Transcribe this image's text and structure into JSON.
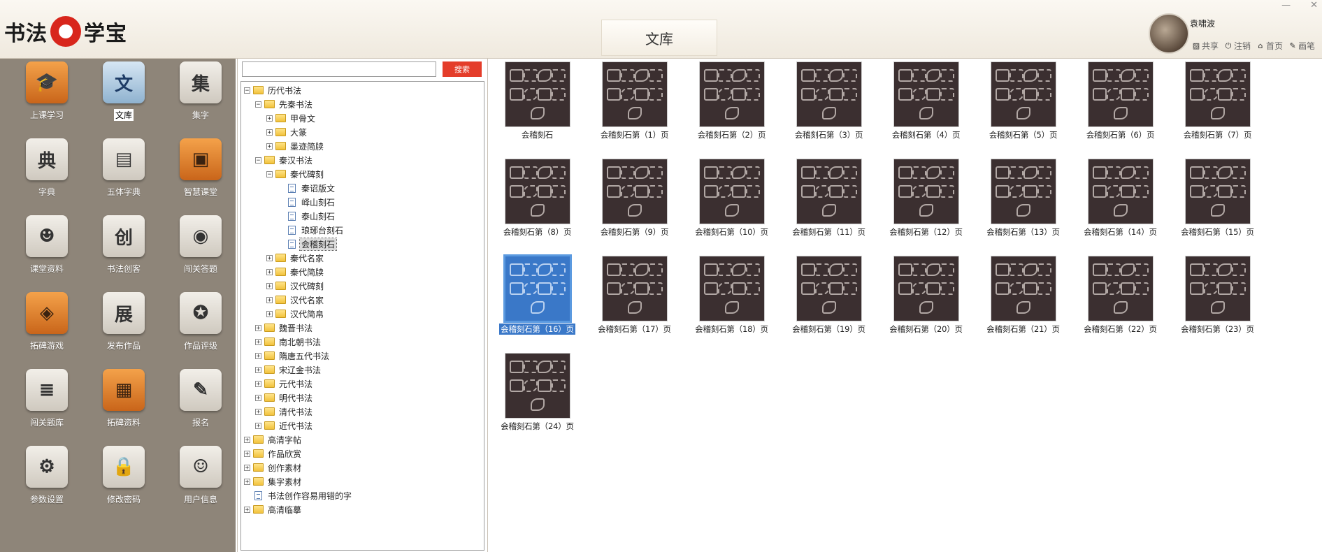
{
  "header": {
    "logo_left": "书法",
    "logo_right": "学宝",
    "page_title": "文库",
    "user_name": "袁啸波",
    "links": [
      {
        "label": "共享",
        "icon": "image-icon"
      },
      {
        "label": "注销",
        "icon": "power-icon"
      },
      {
        "label": "首页",
        "icon": "home-icon"
      },
      {
        "label": "画笔",
        "icon": "pencil-icon"
      }
    ]
  },
  "nav": {
    "items": [
      {
        "label": "上课学习",
        "glyph": "🎓",
        "style": "o"
      },
      {
        "label": "文库",
        "glyph": "文",
        "style": "b",
        "selected": true
      },
      {
        "label": "集字",
        "glyph": "集",
        "style": "g"
      },
      {
        "label": "字典",
        "glyph": "典",
        "style": "g"
      },
      {
        "label": "五体字典",
        "glyph": "▤",
        "style": "g"
      },
      {
        "label": "智慧课堂",
        "glyph": "▣",
        "style": "o"
      },
      {
        "label": "课堂资料",
        "glyph": "☻",
        "style": "g"
      },
      {
        "label": "书法创客",
        "glyph": "创",
        "style": "g"
      },
      {
        "label": "闯关答题",
        "glyph": "◉",
        "style": "g"
      },
      {
        "label": "拓碑游戏",
        "glyph": "◈",
        "style": "o"
      },
      {
        "label": "发布作品",
        "glyph": "展",
        "style": "g"
      },
      {
        "label": "作品评级",
        "glyph": "✪",
        "style": "g"
      },
      {
        "label": "闯关题库",
        "glyph": "≣",
        "style": "g"
      },
      {
        "label": "拓碑资料",
        "glyph": "▦",
        "style": "o"
      },
      {
        "label": "报名",
        "glyph": "✎",
        "style": "g"
      },
      {
        "label": "参数设置",
        "glyph": "⚙",
        "style": "g"
      },
      {
        "label": "修改密码",
        "glyph": "🔒",
        "style": "g"
      },
      {
        "label": "用户信息",
        "glyph": "☺",
        "style": "g"
      }
    ]
  },
  "search": {
    "value": "",
    "placeholder": "",
    "button_label": "搜索"
  },
  "tree": [
    {
      "label": "历代书法",
      "level": 0,
      "toggle": "−",
      "type": "folder"
    },
    {
      "label": "先秦书法",
      "level": 1,
      "toggle": "−",
      "type": "folder"
    },
    {
      "label": "甲骨文",
      "level": 2,
      "toggle": "+",
      "type": "folder"
    },
    {
      "label": "大篆",
      "level": 2,
      "toggle": "+",
      "type": "folder"
    },
    {
      "label": "墨迹简牍",
      "level": 2,
      "toggle": "+",
      "type": "folder"
    },
    {
      "label": "秦汉书法",
      "level": 1,
      "toggle": "−",
      "type": "folder"
    },
    {
      "label": "秦代碑刻",
      "level": 2,
      "toggle": "−",
      "type": "folder"
    },
    {
      "label": "秦诏版文",
      "level": 3,
      "toggle": "",
      "type": "doc"
    },
    {
      "label": "峄山刻石",
      "level": 3,
      "toggle": "",
      "type": "doc"
    },
    {
      "label": "泰山刻石",
      "level": 3,
      "toggle": "",
      "type": "doc"
    },
    {
      "label": "琅琊台刻石",
      "level": 3,
      "toggle": "",
      "type": "doc"
    },
    {
      "label": "会稽刻石",
      "level": 3,
      "toggle": "",
      "type": "doc",
      "selected": true
    },
    {
      "label": "秦代名家",
      "level": 2,
      "toggle": "+",
      "type": "folder"
    },
    {
      "label": "秦代简牍",
      "level": 2,
      "toggle": "+",
      "type": "folder"
    },
    {
      "label": "汉代碑刻",
      "level": 2,
      "toggle": "+",
      "type": "folder"
    },
    {
      "label": "汉代名家",
      "level": 2,
      "toggle": "+",
      "type": "folder"
    },
    {
      "label": "汉代简帛",
      "level": 2,
      "toggle": "+",
      "type": "folder"
    },
    {
      "label": "魏晋书法",
      "level": 1,
      "toggle": "+",
      "type": "folder"
    },
    {
      "label": "南北朝书法",
      "level": 1,
      "toggle": "+",
      "type": "folder"
    },
    {
      "label": "隋唐五代书法",
      "level": 1,
      "toggle": "+",
      "type": "folder"
    },
    {
      "label": "宋辽金书法",
      "level": 1,
      "toggle": "+",
      "type": "folder"
    },
    {
      "label": "元代书法",
      "level": 1,
      "toggle": "+",
      "type": "folder"
    },
    {
      "label": "明代书法",
      "level": 1,
      "toggle": "+",
      "type": "folder"
    },
    {
      "label": "清代书法",
      "level": 1,
      "toggle": "+",
      "type": "folder"
    },
    {
      "label": "近代书法",
      "level": 1,
      "toggle": "+",
      "type": "folder"
    },
    {
      "label": "高清字帖",
      "level": 0,
      "toggle": "+",
      "type": "folder"
    },
    {
      "label": "作品欣赏",
      "level": 0,
      "toggle": "+",
      "type": "folder"
    },
    {
      "label": "创作素材",
      "level": 0,
      "toggle": "+",
      "type": "folder"
    },
    {
      "label": "集字素材",
      "level": 0,
      "toggle": "+",
      "type": "folder"
    },
    {
      "label": "书法创作容易用错的字",
      "level": 0,
      "toggle": "",
      "type": "doc"
    },
    {
      "label": "高清临摹",
      "level": 0,
      "toggle": "+",
      "type": "folder"
    }
  ],
  "thumbnails": [
    {
      "caption": "会稽刻石"
    },
    {
      "caption": "会稽刻石第（1）页"
    },
    {
      "caption": "会稽刻石第（2）页"
    },
    {
      "caption": "会稽刻石第（3）页"
    },
    {
      "caption": "会稽刻石第（4）页"
    },
    {
      "caption": "会稽刻石第（5）页"
    },
    {
      "caption": "会稽刻石第（6）页"
    },
    {
      "caption": "会稽刻石第（7）页"
    },
    {
      "caption": "会稽刻石第（8）页"
    },
    {
      "caption": "会稽刻石第（9）页"
    },
    {
      "caption": "会稽刻石第（10）页"
    },
    {
      "caption": "会稽刻石第（11）页"
    },
    {
      "caption": "会稽刻石第（12）页"
    },
    {
      "caption": "会稽刻石第（13）页"
    },
    {
      "caption": "会稽刻石第（14）页"
    },
    {
      "caption": "会稽刻石第（15）页"
    },
    {
      "caption": "会稽刻石第（16）页",
      "selected": true
    },
    {
      "caption": "会稽刻石第（17）页"
    },
    {
      "caption": "会稽刻石第（18）页"
    },
    {
      "caption": "会稽刻石第（19）页"
    },
    {
      "caption": "会稽刻石第（20）页"
    },
    {
      "caption": "会稽刻石第（21）页"
    },
    {
      "caption": "会稽刻石第（22）页"
    },
    {
      "caption": "会稽刻石第（23）页"
    },
    {
      "caption": "会稽刻石第（24）页"
    }
  ]
}
